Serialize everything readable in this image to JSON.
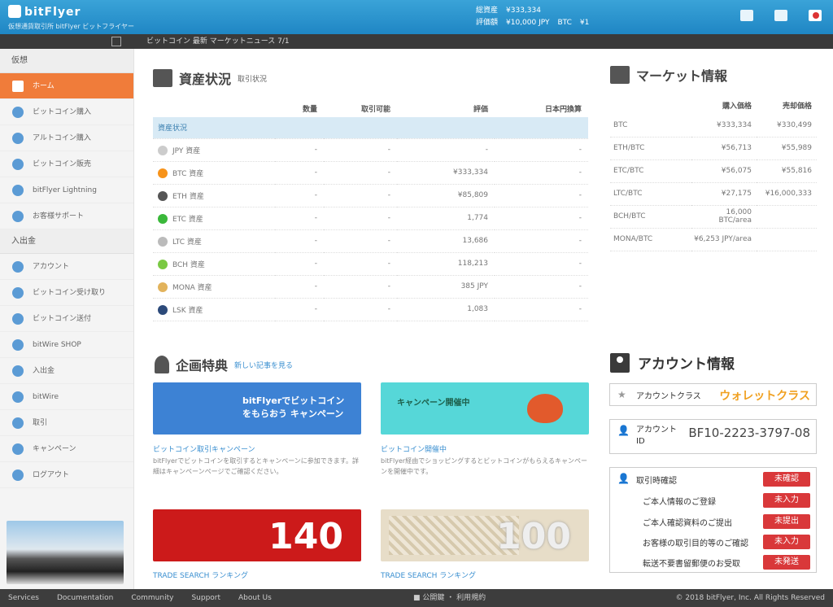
{
  "header": {
    "logo": "bitFlyer",
    "tagline": "仮想通貨取引所 bitFlyer ビットフライヤー",
    "acct_line1": [
      "総資産",
      "¥333,334"
    ],
    "acct_line2": [
      "評価額",
      "¥10,000 JPY",
      "BTC",
      "¥1"
    ]
  },
  "ticker": {
    "text": "ビットコイン 最新 マーケットニュース 7/1"
  },
  "sidebar": {
    "section1": "仮想",
    "items1": [
      {
        "label": "ホーム",
        "active": true
      },
      {
        "label": "ビットコイン購入"
      },
      {
        "label": "アルトコイン購入"
      },
      {
        "label": "ビットコイン販売"
      },
      {
        "label": "bitFlyer Lightning"
      },
      {
        "label": "お客様サポート"
      }
    ],
    "section2": "入出金",
    "items2": [
      {
        "label": "アカウント"
      },
      {
        "label": "ビットコイン受け取り"
      },
      {
        "label": "ビットコイン送付"
      },
      {
        "label": "bitWire SHOP"
      },
      {
        "label": "入出金"
      },
      {
        "label": "bitWire"
      },
      {
        "label": "取引"
      },
      {
        "label": "キャンペーン"
      },
      {
        "label": "ログアウト"
      }
    ]
  },
  "assets": {
    "title": "資産状況",
    "subtitle": "取引状況",
    "columns": [
      "数量",
      "取引可能",
      "評価",
      "日本円換算"
    ],
    "group": "資産状況",
    "rows": [
      {
        "name": "JPY 資産",
        "color": "#cccccc",
        "c1": "-",
        "c2": "-",
        "c3": "-",
        "c4": "-"
      },
      {
        "name": "BTC 資産",
        "color": "#f7931a",
        "c1": "-",
        "c2": "-",
        "c3": "¥333,334",
        "c4": "-"
      },
      {
        "name": "ETH 資産",
        "color": "#555555",
        "c1": "-",
        "c2": "-",
        "c3": "¥85,809",
        "c4": "-"
      },
      {
        "name": "ETC 資産",
        "color": "#3ab83a",
        "c1": "-",
        "c2": "-",
        "c3": "1,774",
        "c4": "-"
      },
      {
        "name": "LTC 資産",
        "color": "#bbbbbb",
        "c1": "-",
        "c2": "-",
        "c3": "13,686",
        "c4": "-"
      },
      {
        "name": "BCH 資産",
        "color": "#7ac943",
        "c1": "-",
        "c2": "-",
        "c3": "118,213",
        "c4": "-"
      },
      {
        "name": "MONA 資産",
        "color": "#e2b35c",
        "c1": "-",
        "c2": "-",
        "c3": "385 JPY",
        "c4": "-"
      },
      {
        "name": "LSK 資産",
        "color": "#2c4a7a",
        "c1": "-",
        "c2": "-",
        "c3": "1,083",
        "c4": "-"
      }
    ]
  },
  "market": {
    "title": "マーケット情報",
    "columns": [
      "購入価格",
      "売却価格"
    ],
    "rows": [
      {
        "name": "BTC",
        "buy": "¥333,334",
        "sell": "¥330,499"
      },
      {
        "name": "ETH/BTC",
        "buy": "¥56,713",
        "sell": "¥55,989"
      },
      {
        "name": "ETC/BTC",
        "buy": "¥56,075",
        "sell": "¥55,816"
      },
      {
        "name": "LTC/BTC",
        "buy": "¥27,175",
        "sell": "¥16,000,333"
      },
      {
        "name": "BCH/BTC",
        "buy": "16,000 BTC/area",
        "sell": ""
      },
      {
        "name": "MONA/BTC",
        "buy": "¥6,253 JPY/area",
        "sell": ""
      }
    ]
  },
  "campaign": {
    "title": "企画特典",
    "link": "新しい記事を見る",
    "items": [
      {
        "banner": "bitFlyerでビットコインをもらおう キャンペーン",
        "title": "ビットコイン取引キャンペーン",
        "body": "bitFlyerでビットコインを取引するとキャンペーンに参加できます。詳細はキャンペーンページでご確認ください。"
      },
      {
        "banner": "キャンペーン開催中",
        "title": "ビットコイン開催中",
        "body": "bitFlyer経由でショッピングするとビットコインがもらえるキャンペーンを開催中です。"
      },
      {
        "banner": "140",
        "title": "TRADE SEARCH ランキング",
        "body": ""
      },
      {
        "banner": "100",
        "title": "TRADE SEARCH ランキング",
        "body": ""
      }
    ]
  },
  "account": {
    "title": "アカウント情報",
    "class_label": "アカウントクラス",
    "class_value": "ウォレットクラス",
    "id_label": "アカウントID",
    "id_value": "BF10-2223-3797-08",
    "verify_label": "取引時確認",
    "verify_status": "未確認",
    "steps": [
      {
        "label": "ご本人情報のご登録",
        "status": "未入力"
      },
      {
        "label": "ご本人確認資料のご提出",
        "status": "未提出"
      },
      {
        "label": "お客様の取引目的等のご確認",
        "status": "未入力"
      },
      {
        "label": "転送不要書留郵便のお受取",
        "status": "未発送"
      }
    ]
  },
  "footer": {
    "links": [
      "Services",
      "Documentation",
      "Community",
      "Support",
      "About Us"
    ],
    "center": "■ 公開鍵 ・ 利用規約",
    "copy": "© 2018 bitFlyer, Inc. All Rights Reserved"
  }
}
